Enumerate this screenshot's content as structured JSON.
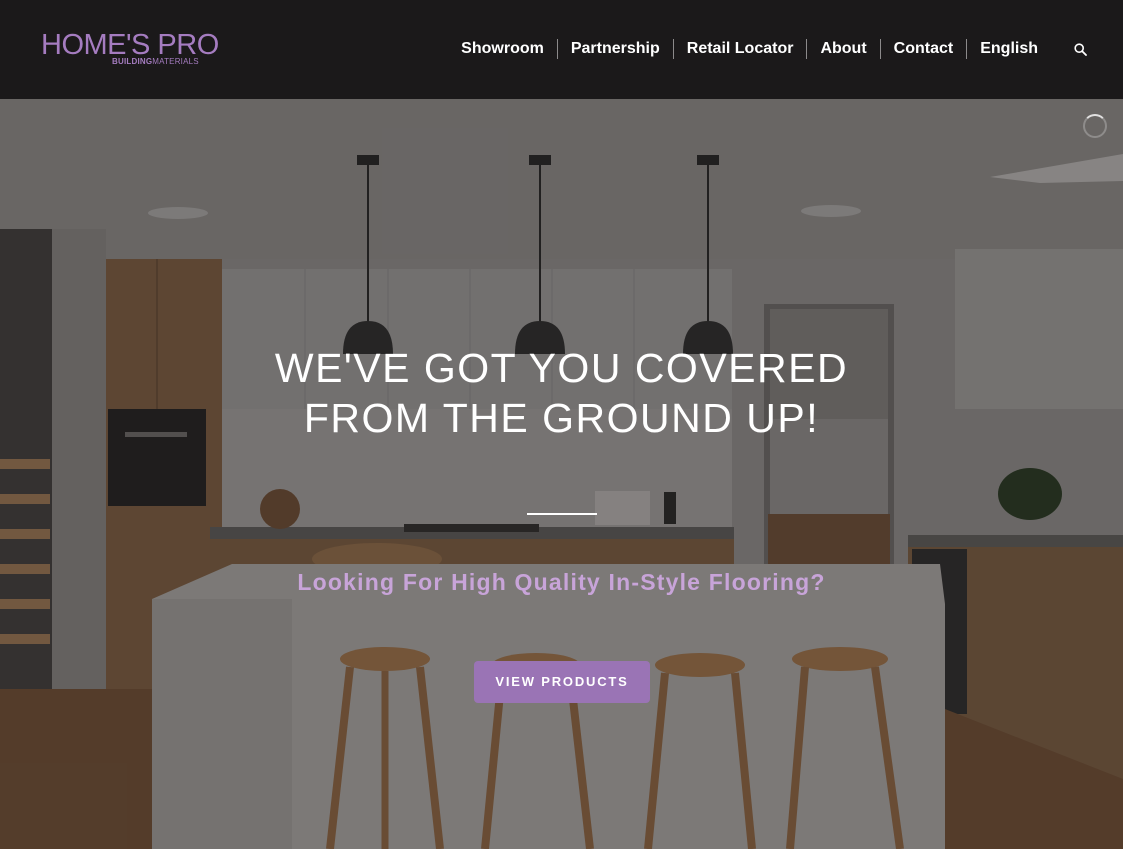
{
  "logo": {
    "main": "HOME'S PRO",
    "sub_bold": "BUILDING",
    "sub_light": "MATERIALS"
  },
  "nav": {
    "items": [
      "Showroom",
      "Partnership",
      "Retail Locator",
      "About",
      "Contact",
      "English"
    ],
    "search_icon": "search-icon"
  },
  "hero": {
    "headline_line1": "WE'VE GOT YOU COVERED",
    "headline_line2": "FROM THE GROUND UP!",
    "subheadline": "Looking For High Quality In-Style Flooring?",
    "cta_label": "VIEW PRODUCTS"
  },
  "colors": {
    "header_bg": "#1b191a",
    "brand_purple": "#a57cc0",
    "cta_bg": "#9a74b5",
    "subheadline": "#c8a4d9"
  }
}
